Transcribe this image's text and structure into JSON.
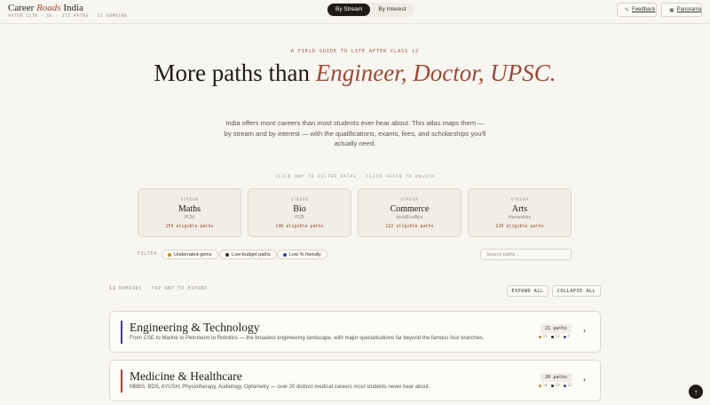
{
  "header": {
    "brand_pre": "Career",
    "brand_accent": "Roads",
    "brand_post": "India",
    "subtitle": "AFTER 12TH · 5k · 175 PATHS · 11 DOMAINS",
    "toggle": [
      {
        "label": "By Stream",
        "active": true
      },
      {
        "label": "By Interest",
        "active": false
      }
    ],
    "feedback_label": "Feedback",
    "panorama_label": "Panorama"
  },
  "hero": {
    "eyebrow": "A FIELD GUIDE TO LIFE AFTER CLASS 12",
    "headline_pre": "More paths than",
    "headline_accent": "Engineer, Doctor, UPSC.",
    "lede": "India offers more careers than most students ever hear about. This atlas maps them — by stream and by interest — with the qualifications, exams, fees, and scholarships you'll actually need."
  },
  "streams_hint": "CLICK ANY TO FILTER PATHS · CLICK AGAIN TO UNLOCK",
  "streams": [
    {
      "tag": "STREAM",
      "name": "Maths",
      "sub": "PCM",
      "count": "154 eligible paths"
    },
    {
      "tag": "STREAM",
      "name": "Bio",
      "sub": "PCB",
      "count": "146 eligible paths"
    },
    {
      "tag": "STREAM",
      "name": "Commerce",
      "sub": "Acct/Eco/Bus",
      "count": "122 eligible paths"
    },
    {
      "tag": "STREAM",
      "name": "Arts",
      "sub": "Humanities",
      "count": "120 eligible paths"
    }
  ],
  "filter": {
    "label": "FILTER",
    "chips": [
      {
        "label": "Underrated gems",
        "color": "#c8862f"
      },
      {
        "label": "Low-budget paths",
        "color": "#2f2b24"
      },
      {
        "label": "Low % friendly",
        "color": "#3b3f8c"
      }
    ],
    "search_placeholder": "Search paths..."
  },
  "domains_header": {
    "count": "11",
    "label": "DOMAINS · TAP ANY TO EXPAND",
    "expand_all": "EXPAND ALL",
    "collapse_all": "COLLAPSE ALL"
  },
  "domains": [
    {
      "title": "Engineering & Technology",
      "desc": "From CSE to Marine to Petroleum to Robotics — the broadest engineering landscape, with major specialisations far beyond the famous four branches.",
      "paths": "21 paths",
      "bar_color": "#3b3f8c",
      "legend": [
        {
          "value": "15",
          "color": "#c8862f"
        },
        {
          "value": "13",
          "color": "#2f2b24"
        },
        {
          "value": "4",
          "color": "#3b3f8c"
        }
      ]
    },
    {
      "title": "Medicine & Healthcare",
      "desc": "MBBS, BDS, AYUSH, Physiotherapy, Audiology, Optometry — over 20 distinct medical careers most students never hear about.",
      "paths": "20 paths",
      "bar_color": "#9a4a38",
      "legend": [
        {
          "value": "14",
          "color": "#c8862f"
        },
        {
          "value": "19",
          "color": "#2f2b24"
        },
        {
          "value": "12",
          "color": "#3b3f8c"
        }
      ]
    }
  ],
  "scroll_top_icon": "arrow-up-icon"
}
